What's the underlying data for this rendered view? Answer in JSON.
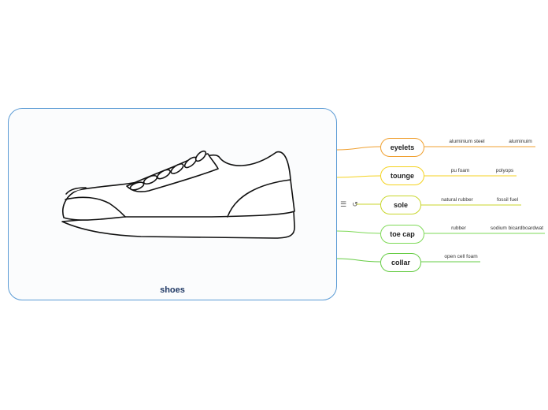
{
  "root": {
    "label": "shoes"
  },
  "branches": [
    {
      "label": "eyelets",
      "color": "#f0a030",
      "leaves": [
        "aluminium steel",
        "aluminuim"
      ]
    },
    {
      "label": "tounge",
      "color": "#f4d21f",
      "leaves": [
        "pu foam",
        "polyops"
      ]
    },
    {
      "label": "sole",
      "color": "#c8d62b",
      "leaves": [
        "natural rubber",
        "fossil fuel"
      ]
    },
    {
      "label": "toe cap",
      "color": "#7ed957",
      "leaves": [
        "rubber",
        "sodium bicardboardwat"
      ]
    },
    {
      "label": "collar",
      "color": "#66cc44",
      "leaves": [
        "open cell foam"
      ]
    }
  ],
  "tools": {
    "menu_icon": "menu-icon",
    "link_icon": "link-icon"
  }
}
